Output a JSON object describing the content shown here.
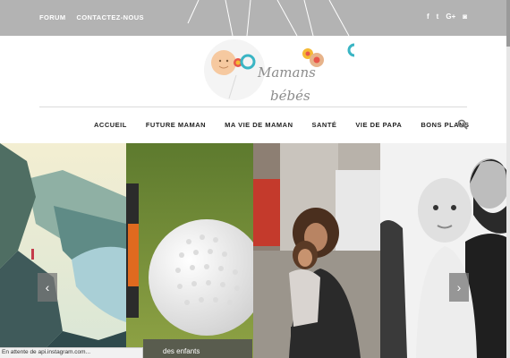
{
  "topbar": {
    "links": [
      "FORUM",
      "CONTACTEZ-NOUS"
    ],
    "social": {
      "facebook": "f",
      "twitter": "t",
      "googleplus": "G+",
      "instagram": "◙"
    }
  },
  "logo": {
    "line1": "Mamans",
    "line2": "bébés"
  },
  "nav": {
    "items": [
      "ACCUEIL",
      "FUTURE MAMAN",
      "MA VIE DE MAMAN",
      "SANTÉ",
      "VIE DE PAPA",
      "BONS PLANS"
    ]
  },
  "slider": {
    "prev": "‹",
    "next": "›",
    "caption": "des enfants"
  },
  "status": {
    "text": "En attente de api.instagram.com..."
  }
}
